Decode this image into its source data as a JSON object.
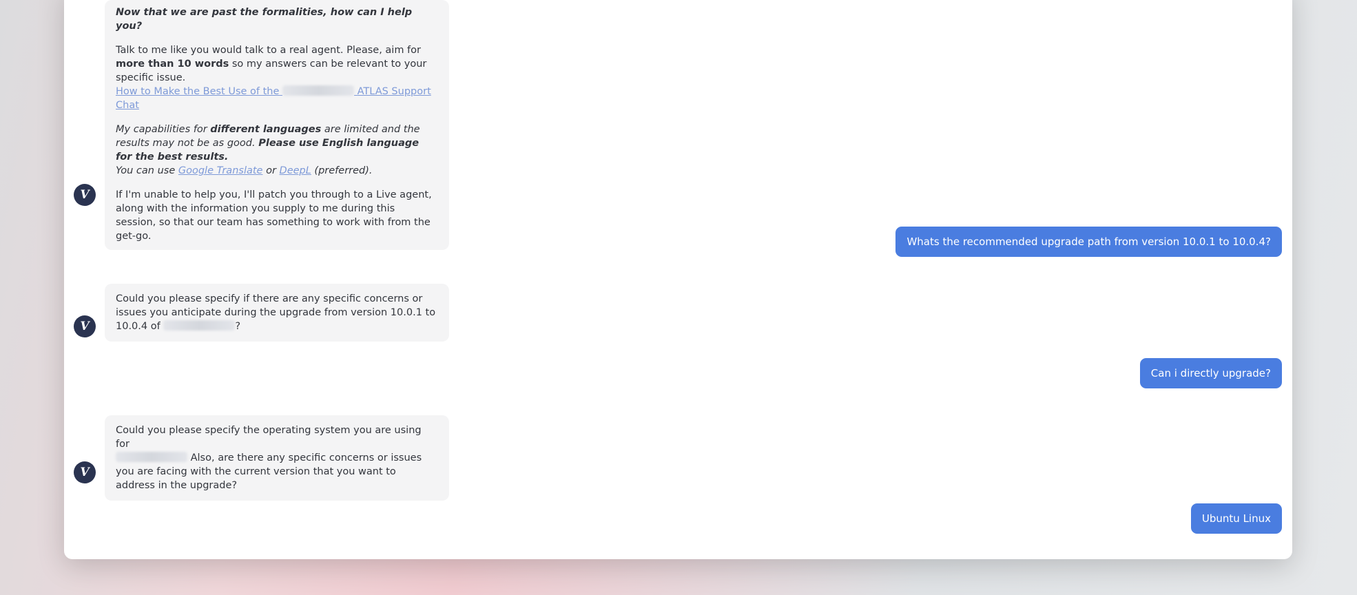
{
  "bot_avatar_glyph": "V",
  "messages": [
    {
      "role": "bot",
      "intro": "Now that we are past the formalities, how can I help you?",
      "para2_a": "Talk to me like you would talk to a real agent. Please, aim for ",
      "para2_b": "more than 10 words",
      "para2_c": " so my answers can be relevant to your specific issue.",
      "link_a": "How to Make the Best Use of the",
      "link_b": "ATLAS Support Chat",
      "para3_a": "My capabilities for ",
      "para3_b": "different languages",
      "para3_c": " are limited and the results may not be as good. ",
      "para3_d": "Please use English language for the best results.",
      "para3_e": "You can use ",
      "link_google": "Google Translate",
      "para3_f": " or ",
      "link_deepl": "DeepL",
      "para3_g": " (preferred).",
      "para4": "If I'm unable to help you, I'll patch you through to a Live agent, along with the information you supply to me during this session, so that our team has something to work with from the get-go."
    },
    {
      "role": "user",
      "text": "Whats the recommended upgrade path from version 10.0.1 to 10.0.4?"
    },
    {
      "role": "bot",
      "text_a": "Could you please specify if there are any specific concerns or issues you anticipate during the upgrade from version 10.0.1 to 10.0.4 of ",
      "text_b": "?"
    },
    {
      "role": "user",
      "text": "Can i directly upgrade?"
    },
    {
      "role": "bot",
      "text_a": "Could you please specify the operating system you are using for",
      "text_b": " Also, are there any specific concerns or issues you are facing with the current version that you want to address in the upgrade?"
    },
    {
      "role": "user",
      "text": "Ubuntu Linux"
    }
  ],
  "colors": {
    "user_bubble": "#4a7de0",
    "bot_bubble": "#f4f4f5",
    "avatar": "#2a3350",
    "link": "#7e9ad8"
  }
}
